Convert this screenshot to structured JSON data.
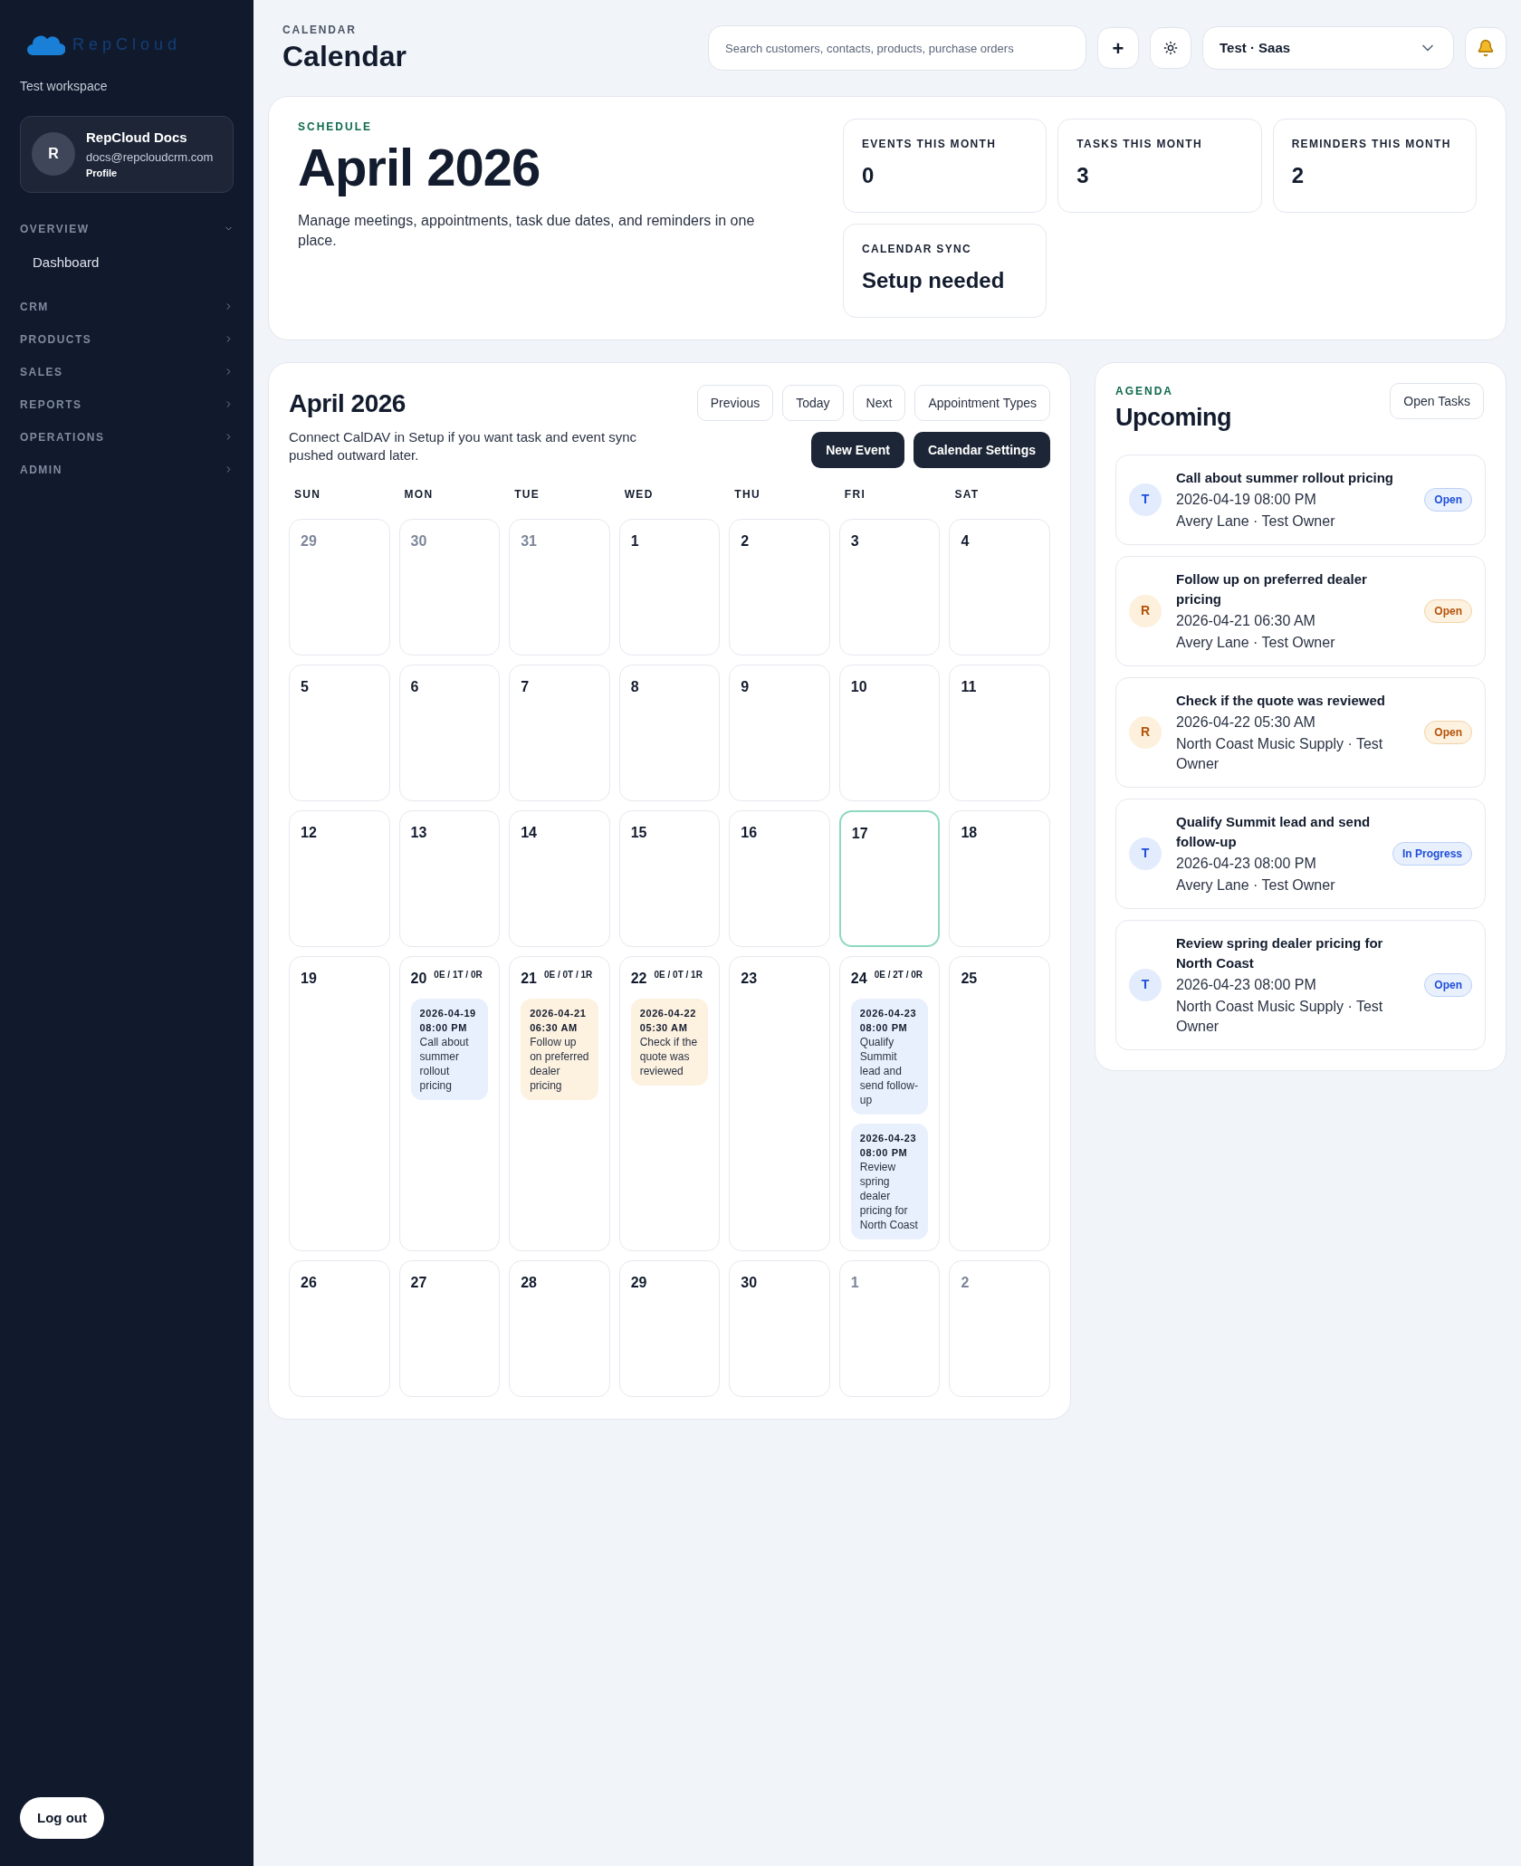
{
  "sidebar": {
    "logo": "RepCloud",
    "workspace": "Test workspace",
    "profile": {
      "initial": "R",
      "name": "RepCloud Docs",
      "email": "docs@repcloudcrm.com",
      "link": "Profile"
    },
    "sections": [
      {
        "label": "OVERVIEW",
        "expanded": true,
        "children": [
          {
            "label": "Dashboard"
          }
        ]
      },
      {
        "label": "CRM",
        "expanded": false
      },
      {
        "label": "PRODUCTS",
        "expanded": false
      },
      {
        "label": "SALES",
        "expanded": false
      },
      {
        "label": "REPORTS",
        "expanded": false
      },
      {
        "label": "OPERATIONS",
        "expanded": false
      },
      {
        "label": "ADMIN",
        "expanded": false
      }
    ],
    "logout": "Log out"
  },
  "header": {
    "eyebrow": "CALENDAR",
    "title": "Calendar",
    "search": {
      "placeholder": "Search customers, contacts, products, purchase orders"
    },
    "add": "+",
    "workspace": "Test · Saas"
  },
  "schedule": {
    "eyebrow": "SCHEDULE",
    "title": "April 2026",
    "description": "Manage meetings, appointments, task due dates, and reminders in one place.",
    "stats": [
      {
        "label": "EVENTS THIS MONTH",
        "value": "0"
      },
      {
        "label": "TASKS THIS MONTH",
        "value": "3"
      },
      {
        "label": "REMINDERS THIS MONTH",
        "value": "2"
      },
      {
        "label": "CALENDAR SYNC",
        "value": "Setup needed"
      }
    ]
  },
  "calendar": {
    "title": "April 2026",
    "note": "Connect CalDAV in Setup if you want task and event sync pushed outward later.",
    "buttons": [
      {
        "label": "Previous",
        "kind": "outline"
      },
      {
        "label": "Today",
        "kind": "outline"
      },
      {
        "label": "Next",
        "kind": "outline"
      },
      {
        "label": "Appointment Types",
        "kind": "outline"
      },
      {
        "label": "New Event",
        "kind": "dark"
      },
      {
        "label": "Calendar Settings",
        "kind": "dark"
      }
    ],
    "weekdays": [
      "SUN",
      "MON",
      "TUE",
      "WED",
      "THU",
      "FRI",
      "SAT"
    ],
    "weeks": [
      [
        {
          "day": "29",
          "muted": true,
          "today": false
        },
        {
          "day": "30",
          "muted": true,
          "today": false
        },
        {
          "day": "31",
          "muted": true,
          "today": false
        },
        {
          "day": "1",
          "muted": false,
          "today": false
        },
        {
          "day": "2",
          "muted": false,
          "today": false
        },
        {
          "day": "3",
          "muted": false,
          "today": false
        },
        {
          "day": "4",
          "muted": false,
          "today": false
        }
      ],
      [
        {
          "day": "5",
          "muted": false,
          "today": false
        },
        {
          "day": "6",
          "muted": false,
          "today": false
        },
        {
          "day": "7",
          "muted": false,
          "today": false
        },
        {
          "day": "8",
          "muted": false,
          "today": false
        },
        {
          "day": "9",
          "muted": false,
          "today": false
        },
        {
          "day": "10",
          "muted": false,
          "today": false
        },
        {
          "day": "11",
          "muted": false,
          "today": false
        }
      ],
      [
        {
          "day": "12",
          "muted": false,
          "today": false
        },
        {
          "day": "13",
          "muted": false,
          "today": false
        },
        {
          "day": "14",
          "muted": false,
          "today": false
        },
        {
          "day": "15",
          "muted": false,
          "today": false
        },
        {
          "day": "16",
          "muted": false,
          "today": false
        },
        {
          "day": "17",
          "muted": false,
          "today": true
        },
        {
          "day": "18",
          "muted": false,
          "today": false
        }
      ],
      [
        {
          "day": "19",
          "muted": false,
          "today": false
        },
        {
          "day": "20",
          "muted": false,
          "today": false,
          "summary": "0E / 1T / 0R",
          "events": [
            {
              "kind": "task",
              "time": "2026-04-19 08:00 PM",
              "title": "Call about summer rollout pricing"
            }
          ]
        },
        {
          "day": "21",
          "muted": false,
          "today": false,
          "summary": "0E / 0T / 1R",
          "events": [
            {
              "kind": "reminder",
              "time": "2026-04-21 06:30 AM",
              "title": "Follow up on preferred dealer pricing"
            }
          ]
        },
        {
          "day": "22",
          "muted": false,
          "today": false,
          "summary": "0E / 0T / 1R",
          "events": [
            {
              "kind": "reminder",
              "time": "2026-04-22 05:30 AM",
              "title": "Check if the quote was reviewed"
            }
          ]
        },
        {
          "day": "23",
          "muted": false,
          "today": false
        },
        {
          "day": "24",
          "muted": false,
          "today": false,
          "summary": "0E / 2T / 0R",
          "events": [
            {
              "kind": "task",
              "time": "2026-04-23 08:00 PM",
              "title": "Qualify Summit lead and send follow-up"
            },
            {
              "kind": "task",
              "time": "2026-04-23 08:00 PM",
              "title": "Review spring dealer pricing for North Coast"
            }
          ]
        },
        {
          "day": "25",
          "muted": false,
          "today": false
        }
      ],
      [
        {
          "day": "26",
          "muted": false,
          "today": false
        },
        {
          "day": "27",
          "muted": false,
          "today": false
        },
        {
          "day": "28",
          "muted": false,
          "today": false
        },
        {
          "day": "29",
          "muted": false,
          "today": false
        },
        {
          "day": "30",
          "muted": false,
          "today": false
        },
        {
          "day": "1",
          "muted": true,
          "today": false
        },
        {
          "day": "2",
          "muted": true,
          "today": false
        }
      ]
    ]
  },
  "agenda": {
    "eyebrow": "AGENDA",
    "title": "Upcoming",
    "button": "Open Tasks",
    "items": [
      {
        "kind": "task",
        "badge": "T",
        "title": "Call about summer rollout pricing",
        "time": "2026-04-19 08:00 PM",
        "meta": "Avery Lane · Test Owner",
        "status": "Open"
      },
      {
        "kind": "reminder",
        "badge": "R",
        "title": "Follow up on preferred dealer pricing",
        "time": "2026-04-21 06:30 AM",
        "meta": "Avery Lane · Test Owner",
        "status": "Open"
      },
      {
        "kind": "reminder",
        "badge": "R",
        "title": "Check if the quote was reviewed",
        "time": "2026-04-22 05:30 AM",
        "meta": "North Coast Music Supply · Test Owner",
        "status": "Open"
      },
      {
        "kind": "task",
        "badge": "T",
        "title": "Qualify Summit lead and send follow-up",
        "time": "2026-04-23 08:00 PM",
        "meta": "Avery Lane · Test Owner",
        "status": "In Progress"
      },
      {
        "kind": "task",
        "badge": "T",
        "title": "Review spring dealer pricing for North Coast",
        "time": "2026-04-23 08:00 PM",
        "meta": "North Coast Music Supply · Test Owner",
        "status": "Open"
      }
    ]
  }
}
